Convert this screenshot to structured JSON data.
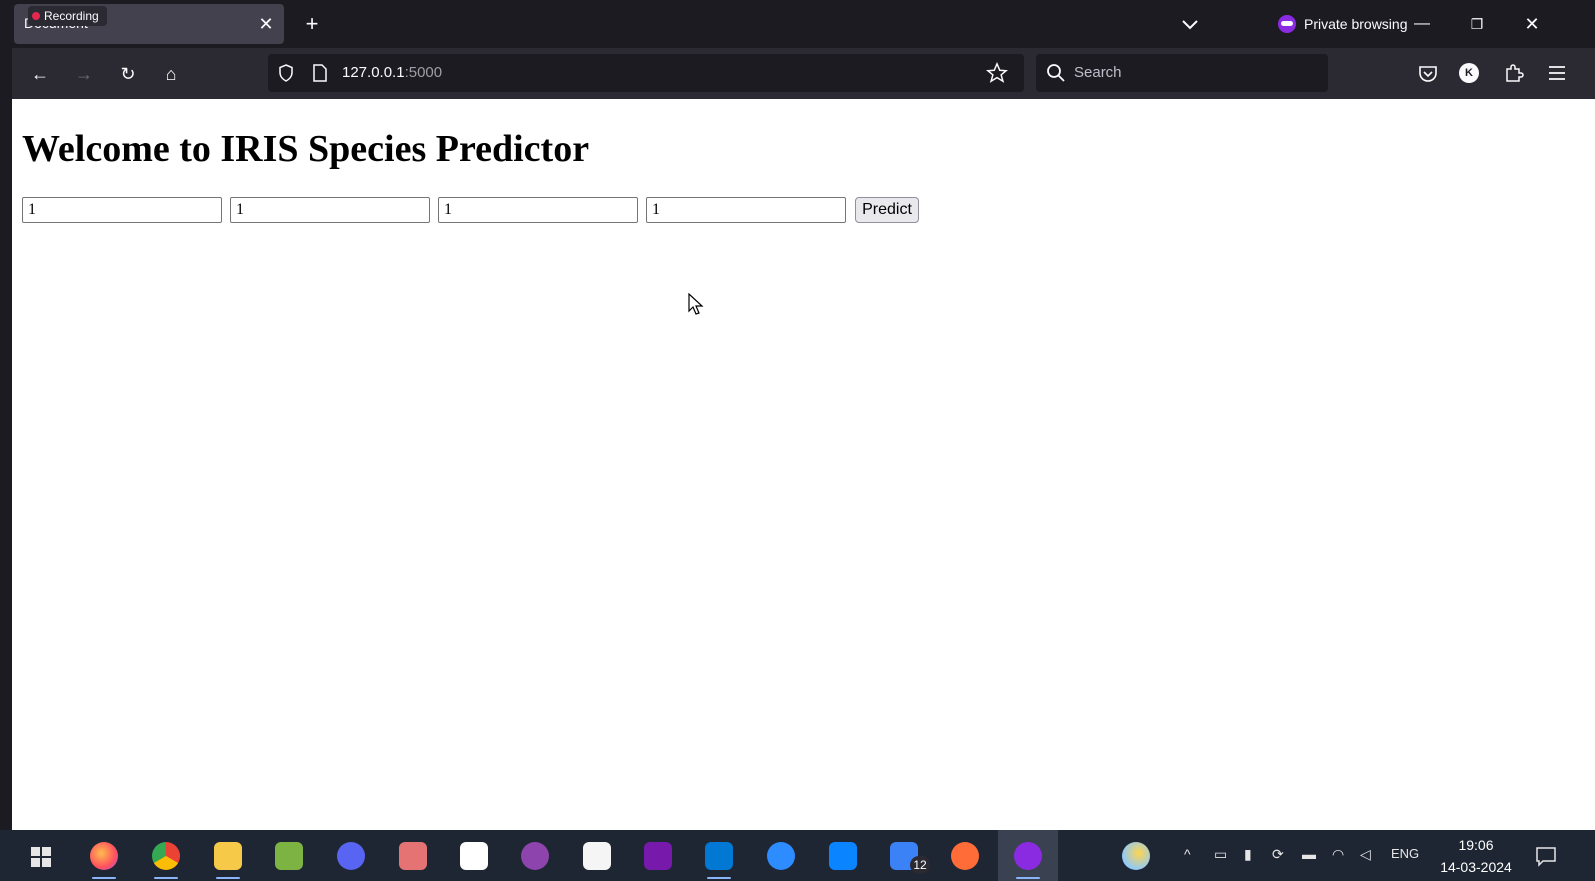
{
  "browser": {
    "recording_label": "Recording",
    "tab_title": "Document",
    "private_label": "Private browsing",
    "url_host": "127.0.0.1",
    "url_port": ":5000",
    "search_placeholder": "Search",
    "avatar_letter": "K"
  },
  "page": {
    "title": "Welcome to IRIS Species Predictor",
    "fields": [
      "1",
      "1",
      "1",
      "1"
    ],
    "predict_label": "Predict"
  },
  "taskbar": {
    "apps": [
      "windows-start",
      "firefox",
      "chrome",
      "file-explorer",
      "sheets",
      "discord",
      "paint",
      "notion",
      "github-desktop",
      "writer",
      "onenote",
      "vscode",
      "zoom",
      "remote-desktop",
      "todo",
      "postman",
      "private-firefox"
    ],
    "todo_badge": "12",
    "language": "ENG",
    "time": "19:06",
    "date": "14-03-2024"
  },
  "colors": {
    "chrome_dark": "#1c1b22",
    "toolbar": "#2b2a33",
    "private_purple": "#8a2be2",
    "taskbar": "#1f2633"
  }
}
